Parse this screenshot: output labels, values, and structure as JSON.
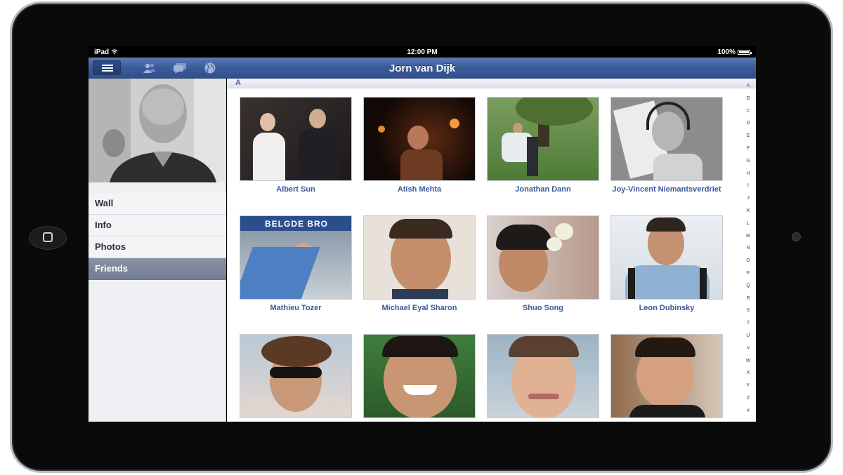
{
  "status_bar": {
    "carrier": "iPad",
    "time": "12:00 PM",
    "battery": "100%"
  },
  "nav": {
    "title": "Jorn van Dijk",
    "icons": [
      "menu-icon",
      "friends-icon",
      "messages-icon",
      "notifications-globe-icon"
    ]
  },
  "sidebar": {
    "items": [
      {
        "label": "Wall",
        "active": false
      },
      {
        "label": "Info",
        "active": false
      },
      {
        "label": "Photos",
        "active": false
      },
      {
        "label": "Friends",
        "active": true
      }
    ]
  },
  "friends": {
    "section_letter": "A",
    "list": [
      {
        "name": "Albert Sun"
      },
      {
        "name": "Atish Mehta"
      },
      {
        "name": "Jonathan Dann"
      },
      {
        "name": "Joy-Vincent Niemantsverdriet"
      },
      {
        "name": "Mathieu Tozer"
      },
      {
        "name": "Michael Eyal Sharon"
      },
      {
        "name": "Shuo Song"
      },
      {
        "name": "Leon Dubinsky"
      },
      {
        "name": ""
      },
      {
        "name": ""
      },
      {
        "name": ""
      },
      {
        "name": ""
      }
    ]
  },
  "index": [
    "A",
    "B",
    "C",
    "D",
    "E",
    "F",
    "G",
    "H",
    "I",
    "J",
    "K",
    "L",
    "M",
    "N",
    "O",
    "P",
    "Q",
    "R",
    "S",
    "T",
    "U",
    "V",
    "W",
    "X",
    "Y",
    "Z",
    "#"
  ],
  "colors": {
    "nav_bar": "#3a5a98",
    "link": "#3b5998",
    "sidebar_active": "#7b8597"
  }
}
